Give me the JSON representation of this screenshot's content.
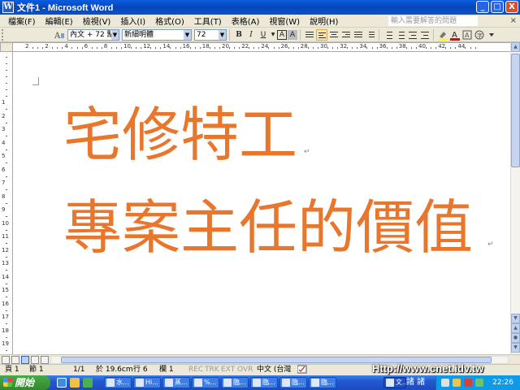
{
  "window": {
    "title": "文件1 - Microsoft Word",
    "app_icon_letter": "W",
    "controls": [
      "_",
      "□",
      "X"
    ]
  },
  "menubar": {
    "items": [
      "檔案(F)",
      "編輯(E)",
      "檢視(V)",
      "插入(I)",
      "格式(O)",
      "工具(T)",
      "表格(A)",
      "視窗(W)",
      "說明(H)"
    ],
    "help_placeholder": "輸入需要解答的問題",
    "close_glyph": "×"
  },
  "toolbar": {
    "style_value": "內文 + 72 點, ſ",
    "font_value": "新細明體",
    "size_value": "72",
    "bold": "B",
    "italic": "I",
    "underline": "U",
    "char_border": "A",
    "char_shading": "A"
  },
  "ruler": {
    "numbers": [
      "2",
      "2",
      "4",
      "6",
      "8",
      "10",
      "12",
      "14",
      "16",
      "18",
      "20",
      "22",
      "24",
      "26",
      "28",
      "30",
      "32",
      "34",
      "36",
      "38",
      "40",
      "42",
      "44"
    ],
    "v_numbers": [
      "1",
      "2",
      "3",
      "4",
      "5",
      "6",
      "7",
      "8",
      "9",
      "10",
      "11",
      "12",
      "13",
      "14",
      "15",
      "16",
      "17",
      "18",
      "19"
    ]
  },
  "document": {
    "line1": "宅修特工",
    "line2": "專案主任的價值",
    "paragraph_mark": "↵",
    "text_color": "#e8762c"
  },
  "statusbar": {
    "page": "頁 1",
    "section": "節 1",
    "page_of": "1/1",
    "position": "於 19.6cm",
    "line": "行 6",
    "column": "欄 1",
    "rec": "REC",
    "trk": "TRK",
    "ext": "EXT",
    "ovr": "OVR",
    "language": "中文 (台灣"
  },
  "taskbar": {
    "start_label": "開始",
    "tasks": [
      "水...",
      "Hi...",
      "蒸...",
      "%...",
      "臨...",
      "臨...",
      "臨...",
      "臨...",
      "文..."
    ],
    "ime_text": "諸 諸",
    "clock": "22:26"
  },
  "watermark": "Http://www.cnet.idv.tw"
}
